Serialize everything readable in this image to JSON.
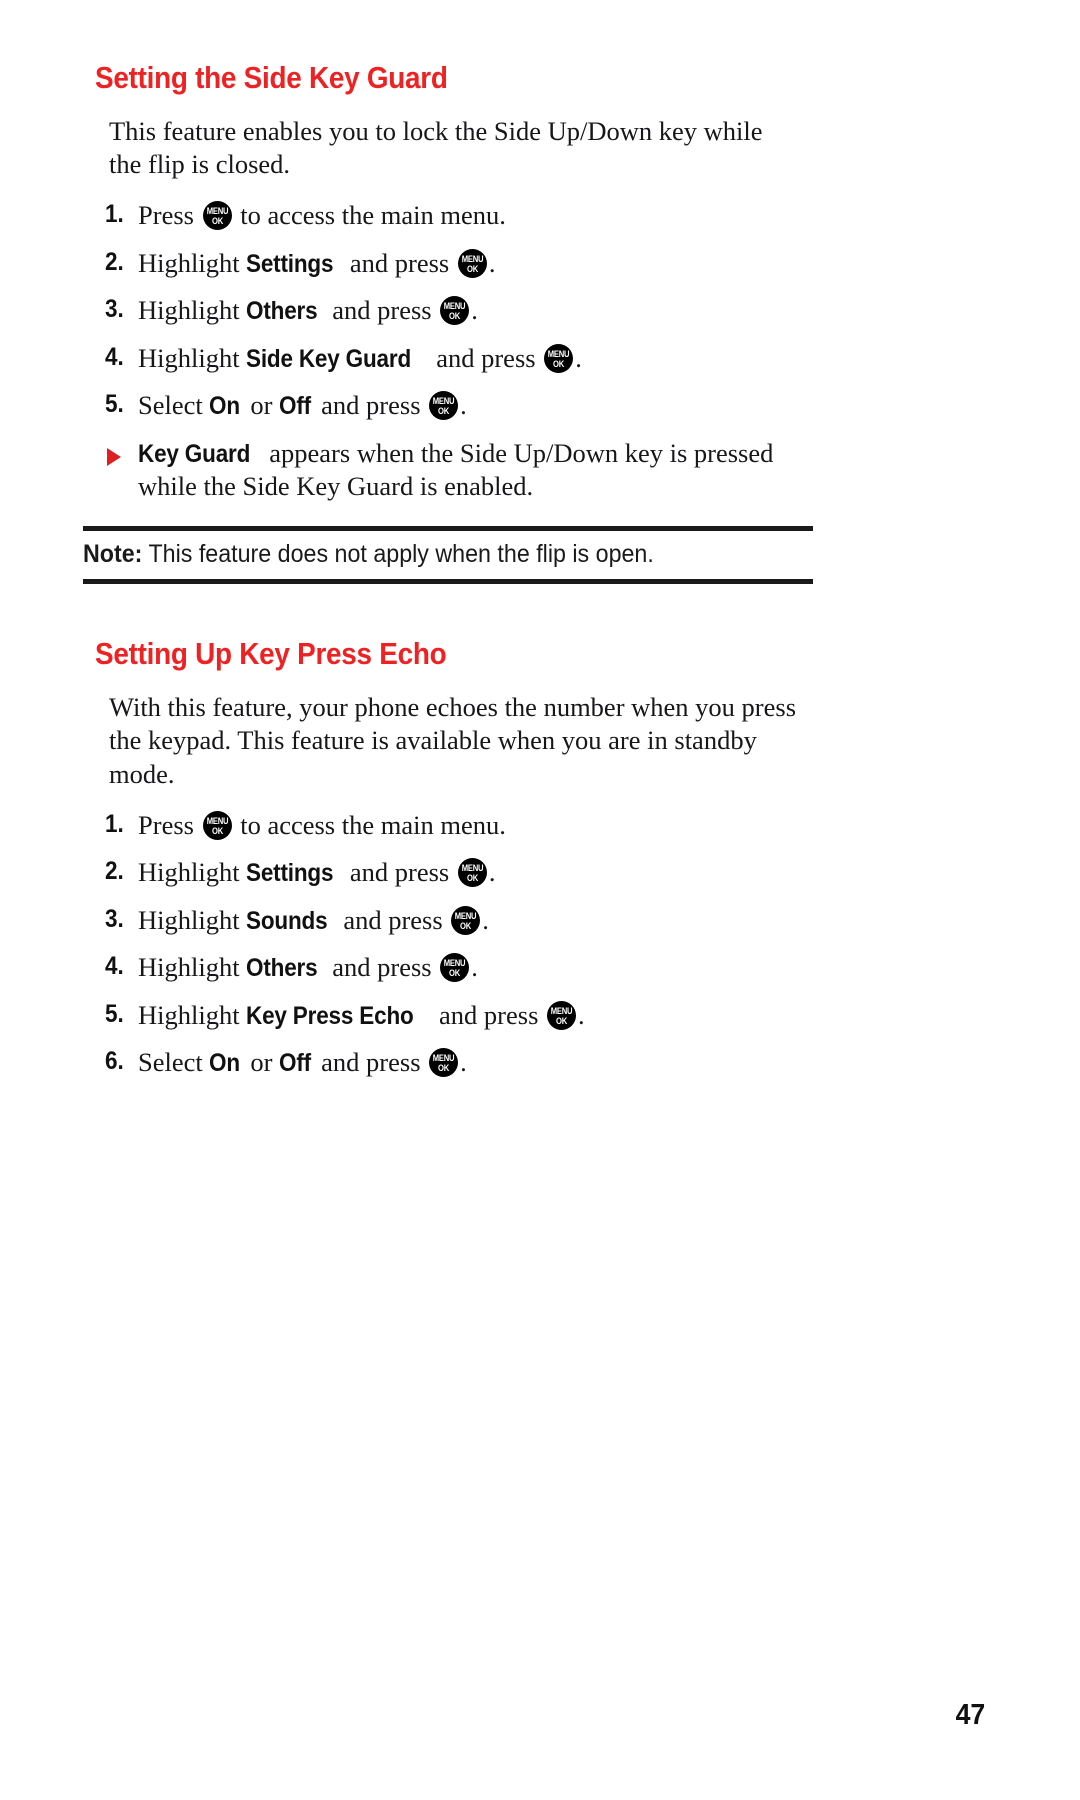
{
  "page": {
    "number": "47",
    "accent_color": "#ee2222",
    "text_color": "#17171a",
    "background": "#ffffff"
  },
  "icons": {
    "menu_ok_key": {
      "line1": "MENU",
      "line2": "OK",
      "name": "menu-ok-key-icon"
    },
    "bullet_triangle": {
      "glyph": "▶",
      "color": "#e02020",
      "name": "red-triangle-bullet-icon"
    }
  },
  "sections": [
    {
      "title": "Setting the Side Key Guard",
      "paragraph": "This feature enables you to lock the Side Up/Down key while the flip is closed.",
      "steps": [
        {
          "num": "1.",
          "pre": "Press ",
          "term": "",
          "mid": "",
          "post": " to access the main menu.",
          "has_key": true,
          "key_pos": "mid"
        },
        {
          "num": "2.",
          "pre": "Highlight ",
          "term": "Settings",
          "mid": " and press ",
          "post": ".",
          "has_key": true,
          "key_pos": "end"
        },
        {
          "num": "3.",
          "pre": "Highlight ",
          "term": "Others",
          "mid": " and press ",
          "post": ".",
          "has_key": true,
          "key_pos": "end"
        },
        {
          "num": "4.",
          "pre": "Highlight ",
          "term": "Side Key Guard",
          "mid": " and press ",
          "post": ".",
          "has_key": true,
          "key_pos": "end"
        },
        {
          "num": "5.",
          "pre": "Select ",
          "term": "On",
          "mid": " or ",
          "term2": "Off",
          "mid2": " and press ",
          "post": ".",
          "has_key": true,
          "key_pos": "end"
        }
      ],
      "bullet": {
        "term": "Key Guard",
        "text": " appears when the Side Up/Down key is pressed while the Side Key Guard is enabled."
      },
      "note": {
        "label": "Note:",
        "text": " This feature does not apply when the flip is open."
      }
    },
    {
      "title": "Setting Up Key Press Echo",
      "paragraph": "With this feature, your phone echoes the number when you press the keypad. This feature is available when you are in standby mode.",
      "steps": [
        {
          "num": "1.",
          "pre": "Press ",
          "term": "",
          "mid": "",
          "post": " to access the main menu.",
          "has_key": true,
          "key_pos": "mid"
        },
        {
          "num": "2.",
          "pre": "Highlight ",
          "term": "Settings",
          "mid": " and press ",
          "post": ".",
          "has_key": true,
          "key_pos": "end"
        },
        {
          "num": "3.",
          "pre": "Highlight ",
          "term": "Sounds",
          "mid": " and press ",
          "post": ".",
          "has_key": true,
          "key_pos": "end"
        },
        {
          "num": "4.",
          "pre": "Highlight ",
          "term": "Others",
          "mid": " and press ",
          "post": ".",
          "has_key": true,
          "key_pos": "end"
        },
        {
          "num": "5.",
          "pre": "Highlight ",
          "term": "Key Press Echo",
          "mid": " and press ",
          "post": ".",
          "has_key": true,
          "key_pos": "end"
        },
        {
          "num": "6.",
          "pre": "Select ",
          "term": "On",
          "mid": " or ",
          "term2": "Off",
          "mid2": " and press ",
          "post": ".",
          "has_key": true,
          "key_pos": "end"
        }
      ]
    }
  ]
}
